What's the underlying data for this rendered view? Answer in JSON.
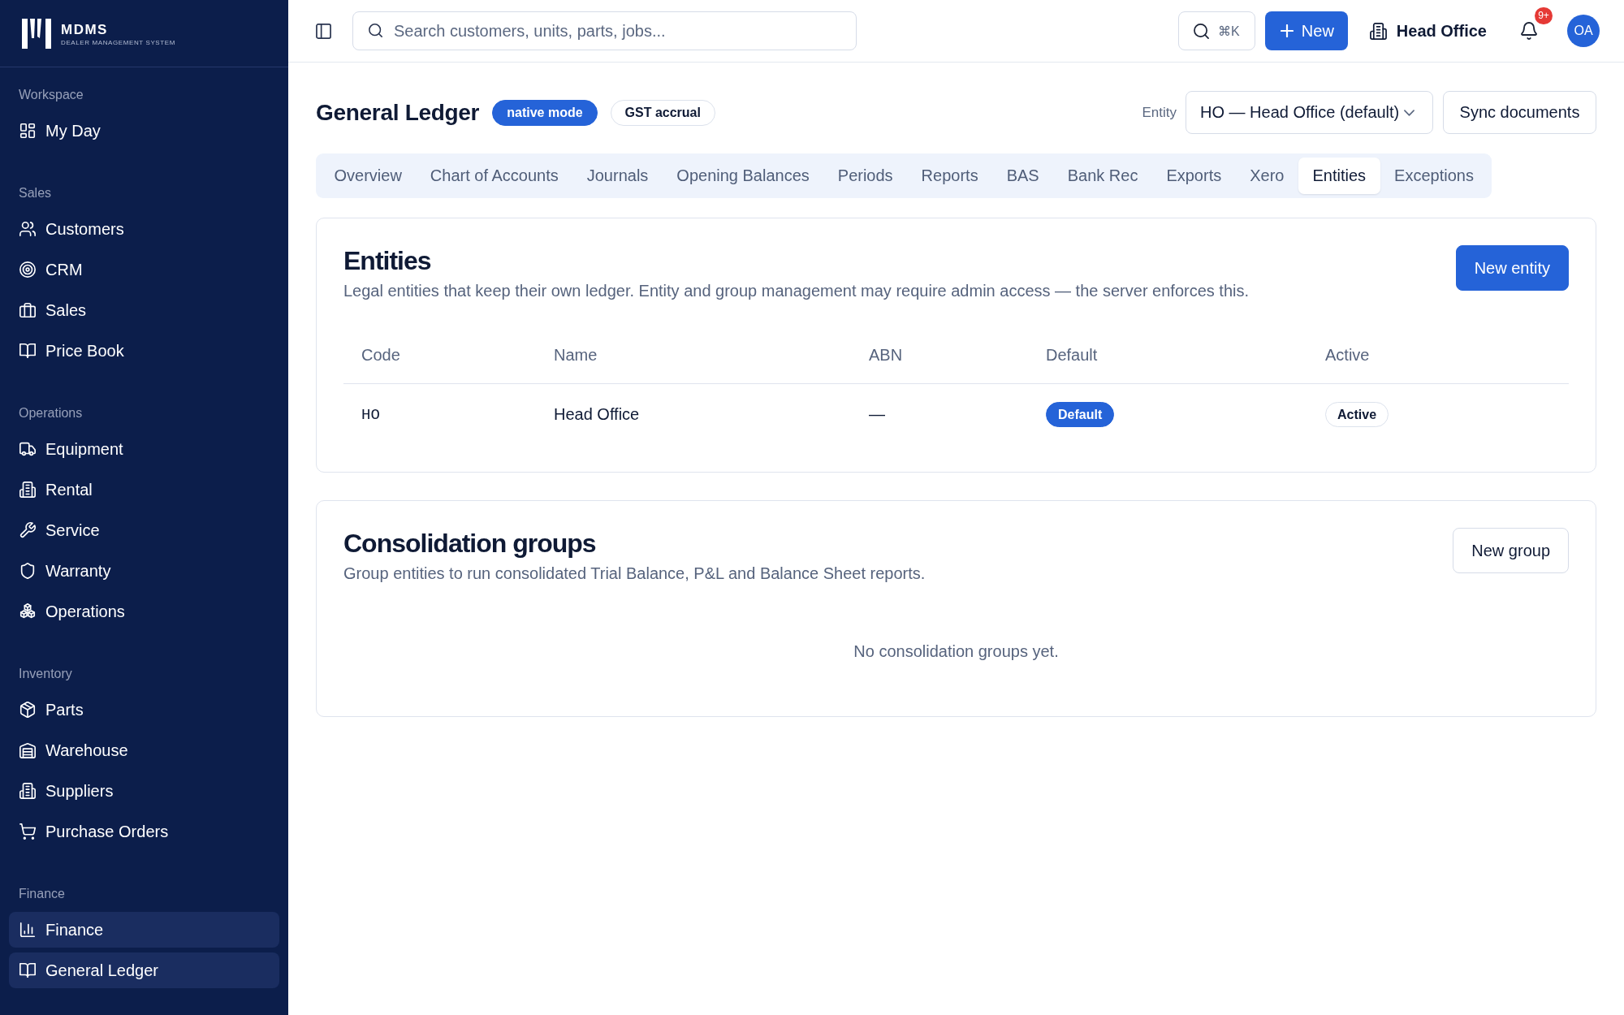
{
  "sidebar": {
    "logo": {
      "name": "MDMS",
      "tagline": "DEALER MANAGEMENT SYSTEM"
    },
    "sections": [
      {
        "label": "Workspace",
        "items": [
          {
            "label": "My Day",
            "selected": false
          }
        ]
      },
      {
        "label": "Sales",
        "items": [
          {
            "label": "Customers",
            "selected": false
          },
          {
            "label": "CRM",
            "selected": false
          },
          {
            "label": "Sales",
            "selected": false
          },
          {
            "label": "Price Book",
            "selected": false
          }
        ]
      },
      {
        "label": "Operations",
        "items": [
          {
            "label": "Equipment",
            "selected": false
          },
          {
            "label": "Rental",
            "selected": false
          },
          {
            "label": "Service",
            "selected": false
          },
          {
            "label": "Warranty",
            "selected": false
          },
          {
            "label": "Operations",
            "selected": false
          }
        ]
      },
      {
        "label": "Inventory",
        "items": [
          {
            "label": "Parts",
            "selected": false
          },
          {
            "label": "Warehouse",
            "selected": false
          },
          {
            "label": "Suppliers",
            "selected": false
          },
          {
            "label": "Purchase Orders",
            "selected": false
          }
        ]
      },
      {
        "label": "Finance",
        "items": [
          {
            "label": "Finance",
            "selected": true
          },
          {
            "label": "General Ledger",
            "selected": true
          }
        ]
      }
    ]
  },
  "topbar": {
    "search": {
      "placeholder": "Search customers, units, parts, jobs..."
    },
    "quick_search": {
      "shortcut": "⌘K"
    },
    "new_button": "New",
    "location": "Head Office",
    "notifications": {
      "badge": "9+"
    },
    "avatar": "OA"
  },
  "page": {
    "title": "General Ledger",
    "badges": [
      {
        "kind": "solid",
        "text": "native mode"
      },
      {
        "kind": "outline",
        "text": "GST accrual"
      }
    ],
    "entity_label": "Entity",
    "entity_select": {
      "value": "HO — Head Office (default)"
    },
    "sync_button": "Sync documents"
  },
  "tabs": [
    {
      "label": "Overview",
      "selected": false
    },
    {
      "label": "Chart of Accounts",
      "selected": false
    },
    {
      "label": "Journals",
      "selected": false
    },
    {
      "label": "Opening Balances",
      "selected": false
    },
    {
      "label": "Periods",
      "selected": false
    },
    {
      "label": "Reports",
      "selected": false
    },
    {
      "label": "BAS",
      "selected": false
    },
    {
      "label": "Bank Rec",
      "selected": false
    },
    {
      "label": "Exports",
      "selected": false
    },
    {
      "label": "Xero",
      "selected": false
    },
    {
      "label": "Entities",
      "selected": true
    },
    {
      "label": "Exceptions",
      "selected": false
    }
  ],
  "cards": [
    {
      "title": "Entities",
      "description": "Legal entities that keep their own ledger. Entity and group management may require admin access — the server enforces this.",
      "button": {
        "label": "New entity",
        "kind": "primary"
      },
      "table": {
        "columns": [
          "Code",
          "Name",
          "ABN",
          "Default",
          "Active"
        ],
        "rows": [
          {
            "cells": [
              {
                "kind": "mono",
                "text": "HO"
              },
              {
                "kind": "text",
                "text": "Head Office"
              },
              {
                "kind": "text",
                "text": "—"
              },
              {
                "kind": "badge-solid",
                "text": "Default"
              },
              {
                "kind": "badge-outline",
                "text": "Active"
              }
            ]
          }
        ]
      }
    },
    {
      "title": "Consolidation groups",
      "description": "Group entities to run consolidated Trial Balance, P&L and Balance Sheet reports.",
      "button": {
        "label": "New group",
        "kind": "secondary"
      },
      "empty_text": "No consolidation groups yet."
    }
  ]
}
